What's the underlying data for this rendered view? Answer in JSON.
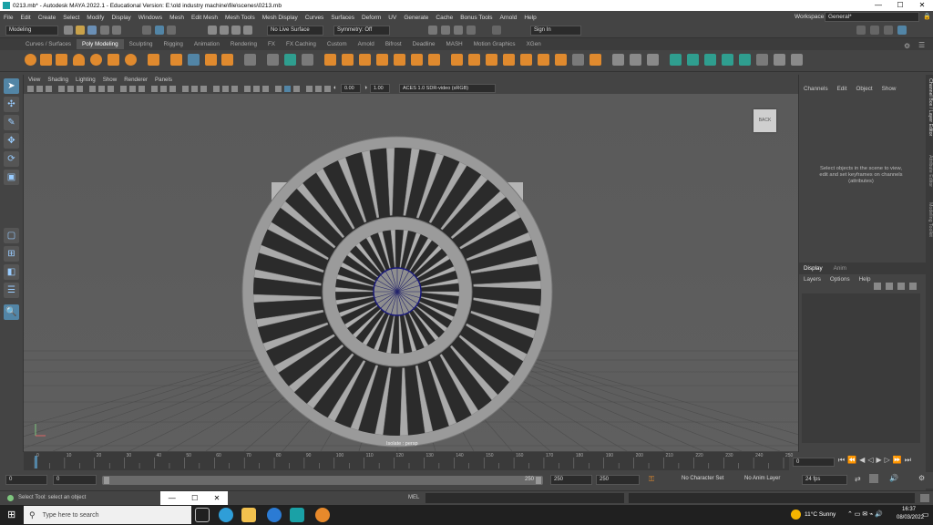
{
  "window": {
    "title": "0213.mb* - Autodesk MAYA 2022.1 - Educational Version: E:\\old industry machine\\file\\scenes\\0213.mb",
    "minimize": "—",
    "maximize": "☐",
    "close": "✕"
  },
  "menus": [
    "File",
    "Edit",
    "Create",
    "Select",
    "Modify",
    "Display",
    "Windows",
    "Mesh",
    "Edit Mesh",
    "Mesh Tools",
    "Mesh Display",
    "Curves",
    "Surfaces",
    "Deform",
    "UV",
    "Generate",
    "Cache",
    "Bonus Tools",
    "Arnold",
    "Help"
  ],
  "workspace": {
    "label": "Workspace:",
    "value": "General*"
  },
  "status_line": {
    "mode": "Modeling",
    "live_surface": "No Live Surface",
    "symmetry": "Symmetry: Off",
    "sign_in": "Sign In"
  },
  "shelf_tabs": [
    "Curves / Surfaces",
    "Poly Modeling",
    "Sculpting",
    "Rigging",
    "Animation",
    "Rendering",
    "FX",
    "FX Caching",
    "Custom",
    "Arnold",
    "Bifrost",
    "Deadline",
    "MASH",
    "Motion Graphics",
    "XGen"
  ],
  "shelf_active_tab": "Poly Modeling",
  "panel_menu": [
    "View",
    "Shading",
    "Lighting",
    "Show",
    "Renderer",
    "Panels"
  ],
  "panel_toolbar": {
    "field1": "0.00",
    "field2": "1.00",
    "color_space": "ACES 1.0 SDR-video (sRGB)"
  },
  "viewport": {
    "view_cube_label": "BACK",
    "camera_label": "Isolate : persp"
  },
  "channel_box": {
    "menu": [
      "Channels",
      "Edit",
      "Object",
      "Show"
    ],
    "empty_message": "Select objects in the scene to view, edit and set keyframes on channels (attributes)"
  },
  "side_tabs": [
    "Channel Box / Layer Editor",
    "Attribute Editor",
    "Modeling Toolkit"
  ],
  "layer_editor": {
    "tabs": [
      "Display",
      "Anim"
    ],
    "menu": [
      "Layers",
      "Options",
      "Help"
    ]
  },
  "time_slider": {
    "ticks": [
      "0",
      "10",
      "20",
      "30",
      "40",
      "50",
      "60",
      "70",
      "80",
      "90",
      "100",
      "110",
      "120",
      "130",
      "140",
      "150",
      "160",
      "170",
      "180",
      "190",
      "200",
      "210",
      "220",
      "230",
      "240",
      "250"
    ],
    "current_frame": "0"
  },
  "range_slider": {
    "start": "0",
    "anim_start": "0",
    "playback_end": "250",
    "end1": "250",
    "end2": "250",
    "character_set": "No Character Set",
    "anim_layer": "No Anim Layer",
    "fps": "24 fps"
  },
  "command_line": {
    "help_text": "Select Tool: select an object",
    "script_type": "MEL"
  },
  "taskbar": {
    "search_placeholder": "Type here to search",
    "weather": "11°C  Sunny",
    "time": "16:37",
    "date": "08/03/2022"
  },
  "colors": {
    "accent": "#5285a6",
    "shelf_orange": "#e08a2e",
    "shelf_teal": "#2f9e8f"
  }
}
